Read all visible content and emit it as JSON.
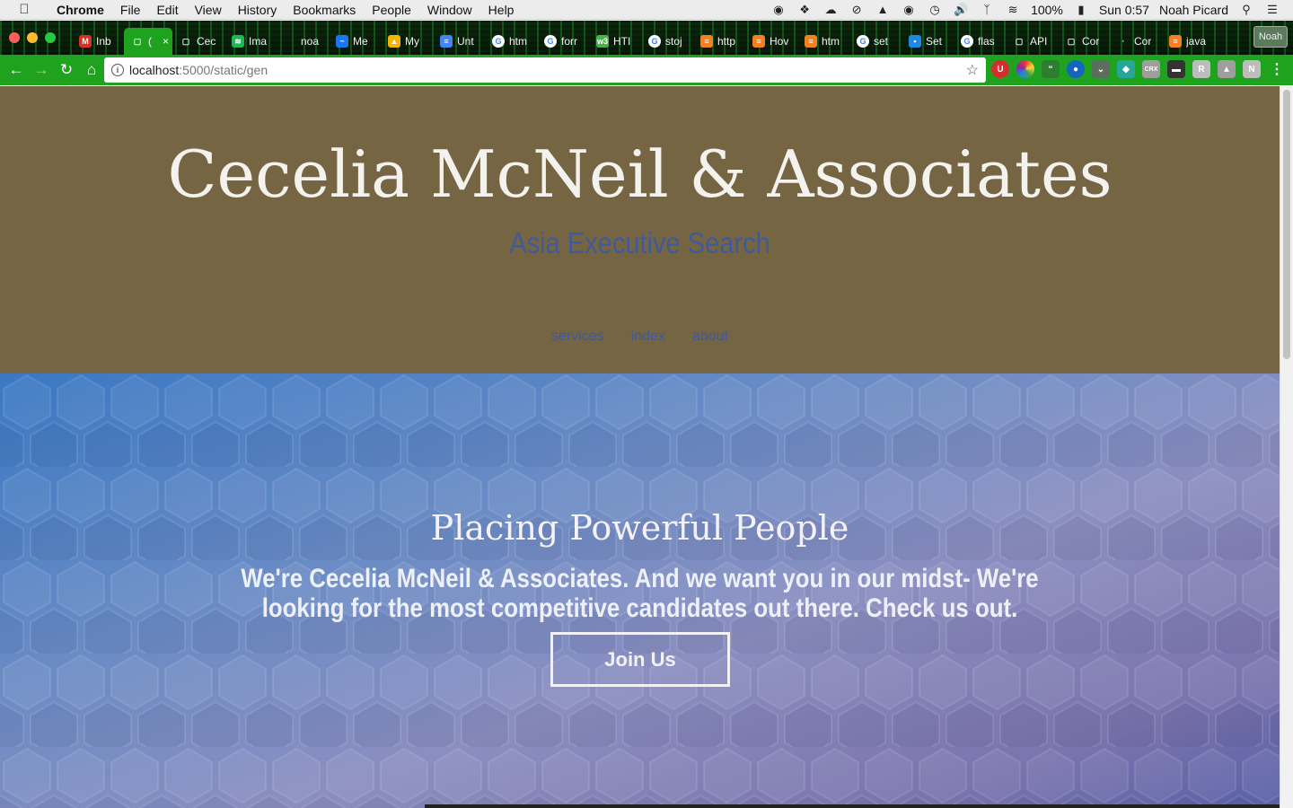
{
  "menubar": {
    "app_name": "Chrome",
    "items": [
      "File",
      "Edit",
      "View",
      "History",
      "Bookmarks",
      "People",
      "Window",
      "Help"
    ],
    "battery": "100%",
    "clock": "Sun 0:57",
    "user": "Noah Picard"
  },
  "tabs": [
    {
      "label": "Inb",
      "icon": "gmail-icon",
      "color": "#d93025",
      "glyph": "M"
    },
    {
      "label": "(",
      "icon": "page-icon",
      "color": "transparent",
      "glyph": "▢",
      "active": true
    },
    {
      "label": "Cec",
      "icon": "page-icon",
      "color": "transparent",
      "glyph": "▢"
    },
    {
      "label": "Ima",
      "icon": "spotify-icon",
      "color": "#1db954",
      "glyph": "≋"
    },
    {
      "label": "noa",
      "icon": "blank-icon",
      "color": "transparent",
      "glyph": ""
    },
    {
      "label": "Me",
      "icon": "messenger-icon",
      "color": "#1877f2",
      "glyph": "~"
    },
    {
      "label": "My",
      "icon": "drive-icon",
      "color": "#f4b400",
      "glyph": "▲"
    },
    {
      "label": "Unt",
      "icon": "docs-icon",
      "color": "#4285f4",
      "glyph": "≡"
    },
    {
      "label": "htm",
      "icon": "google-icon",
      "color": "#ffffff",
      "glyph": "G"
    },
    {
      "label": "forr",
      "icon": "google-icon",
      "color": "#ffffff",
      "glyph": "G"
    },
    {
      "label": "HTI",
      "icon": "w3schools-icon",
      "color": "#4caf50",
      "glyph": "w3"
    },
    {
      "label": "stoj",
      "icon": "google-icon",
      "color": "#ffffff",
      "glyph": "G"
    },
    {
      "label": "http",
      "icon": "stackoverflow-icon",
      "color": "#f48024",
      "glyph": "≡"
    },
    {
      "label": "Hov",
      "icon": "stackoverflow-icon",
      "color": "#f48024",
      "glyph": "≡"
    },
    {
      "label": "htm",
      "icon": "stackoverflow-icon",
      "color": "#f48024",
      "glyph": "≡"
    },
    {
      "label": "set",
      "icon": "google-icon",
      "color": "#ffffff",
      "glyph": "G"
    },
    {
      "label": "Set",
      "icon": "app-icon",
      "color": "#1e88e5",
      "glyph": "▪"
    },
    {
      "label": "flas",
      "icon": "google-icon",
      "color": "#ffffff",
      "glyph": "G"
    },
    {
      "label": "API",
      "icon": "page-icon",
      "color": "transparent",
      "glyph": "▢"
    },
    {
      "label": "Cor",
      "icon": "page-icon",
      "color": "transparent",
      "glyph": "▢"
    },
    {
      "label": "Cor",
      "icon": "blank-icon",
      "color": "transparent",
      "glyph": "·"
    },
    {
      "label": "java",
      "icon": "stackoverflow-icon",
      "color": "#f48024",
      "glyph": "≡"
    }
  ],
  "profile_label": "Noah",
  "address_bar": {
    "host": "localhost",
    "path": ":5000/static/gen"
  },
  "site": {
    "title": "Cecelia McNeil & Associates",
    "subtitle": "Asia Executive Search",
    "nav": [
      "services",
      "index",
      "about"
    ],
    "heading": "Placing Powerful People",
    "body": "We're Cecelia McNeil & Associates. And we want you in our midst- We're looking for the most competitive candidates out there. Check us out.",
    "cta": "Join Us"
  },
  "colors": {
    "hero_bg": "#756543",
    "accent_blue": "#3f5a9c",
    "chrome_green": "#1fa31f"
  }
}
